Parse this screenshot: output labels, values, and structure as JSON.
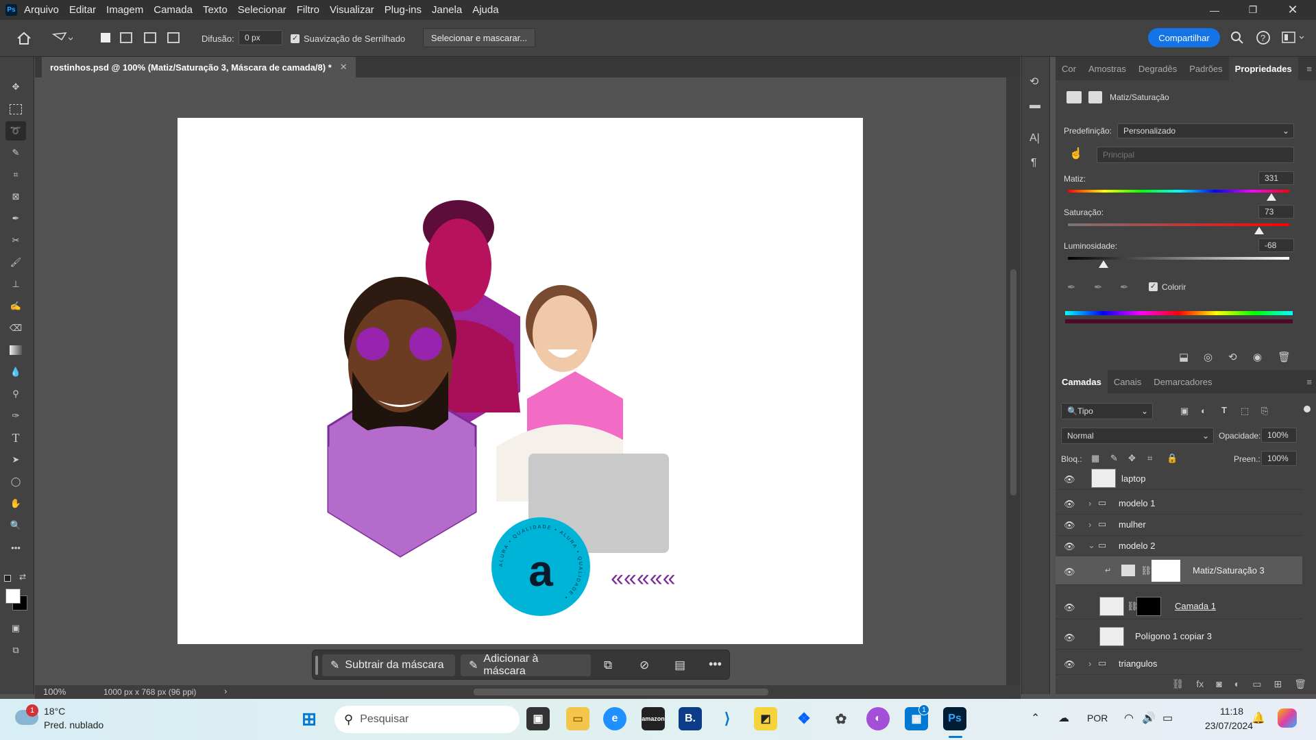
{
  "app": {
    "logo": "Ps"
  },
  "menu": [
    "Arquivo",
    "Editar",
    "Imagem",
    "Camada",
    "Texto",
    "Selecionar",
    "Filtro",
    "Visualizar",
    "Plug-ins",
    "Janela",
    "Ajuda"
  ],
  "options": {
    "difusao_label": "Difusão:",
    "difusao_value": "0 px",
    "antialias_label": "Suavização de Serrilhado",
    "select_mask_button": "Selecionar e mascarar...",
    "share_button": "Compartilhar"
  },
  "document": {
    "tab_title": "rostinhos.psd @ 100% (Matiz/Saturação 3, Máscara de camada/8) *",
    "zoom": "100%",
    "info": "1000 px x 768 px (96 ppi)"
  },
  "artwork": {
    "badge_letter": "a",
    "badge_ring_text": "ALURA • QUALIDADE • ALURA • QUALIDADE •",
    "chevrons": "«««««"
  },
  "context_bar": {
    "subtract": "Subtrair da máscara",
    "add": "Adicionar à máscara"
  },
  "properties": {
    "tabs": [
      "Cor",
      "Amostras",
      "Degradês",
      "Padrões",
      "Propriedades"
    ],
    "active_tab": "Propriedades",
    "adjustment_name": "Matiz/Saturação",
    "preset_label": "Predefinição:",
    "preset_value": "Personalizado",
    "channel_value": "Principal",
    "hue_label": "Matiz:",
    "hue_value": "331",
    "saturation_label": "Saturação:",
    "saturation_value": "73",
    "lightness_label": "Luminosidade:",
    "lightness_value": "-68",
    "colorize_label": "Colorir",
    "hue_level": 0.92,
    "saturation_level": 0.865,
    "lightness_level": 0.16
  },
  "layers_panel": {
    "tabs": [
      "Camadas",
      "Canais",
      "Demarcadores"
    ],
    "active_tab": "Camadas",
    "filter_label": "Tipo",
    "blend_mode": "Normal",
    "opacity_label": "Opacidade:",
    "opacity_value": "100%",
    "lock_label": "Bloq.:",
    "fill_label": "Preen.:",
    "fill_value": "100%",
    "layers": [
      {
        "name": "laptop",
        "type": "smart"
      },
      {
        "name": "modelo 1",
        "type": "group"
      },
      {
        "name": "mulher",
        "type": "group"
      },
      {
        "name": "modelo 2",
        "type": "group-open"
      },
      {
        "name": "Matiz/Saturação 3",
        "type": "adjustment"
      },
      {
        "name": "Camada 1",
        "type": "masked"
      },
      {
        "name": "Polígono 1 copiar 3",
        "type": "smart"
      },
      {
        "name": "triangulos",
        "type": "group"
      }
    ]
  },
  "taskbar": {
    "weather_temp": "18°C",
    "weather_desc": "Pred. nublado",
    "weather_badge": "1",
    "search_placeholder": "Pesquisar",
    "language": "POR",
    "time": "11:18",
    "date": "23/07/2024",
    "store_badge": "1"
  },
  "colors": {
    "accent": "#1473e6",
    "cyan": "#00b4d8",
    "purple": "#b56bcc",
    "magenta": "#c4117a",
    "pink": "#f26bc4"
  }
}
